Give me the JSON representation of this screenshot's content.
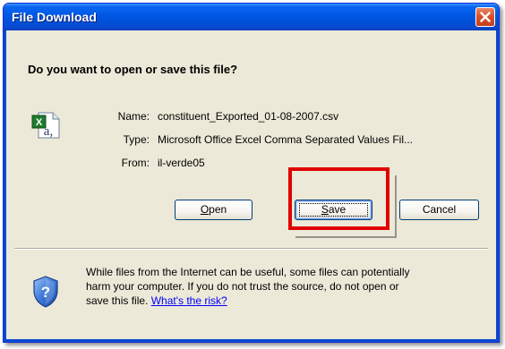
{
  "window": {
    "title": "File Download",
    "close_label": "Close"
  },
  "question": "Do you want to open or save this file?",
  "fields": {
    "name_label": "Name:",
    "name_value": "constituent_Exported_01-08-2007.csv",
    "type_label": "Type:",
    "type_value": "Microsoft Office Excel Comma Separated Values Fil...",
    "from_label": "From:",
    "from_value": "il-verde05"
  },
  "buttons": {
    "open_mnemonic": "O",
    "open_rest": "pen",
    "save_mnemonic": "S",
    "save_rest": "ave",
    "cancel": "Cancel"
  },
  "warning": {
    "line1": "While files from the Internet can be useful, some files can potentially",
    "line2": "harm your computer. If you do not trust the source, do not open or",
    "line3_prefix": "save this file.",
    "link": "What's the risk?"
  },
  "icons": {
    "file": "excel-csv-file-icon",
    "security": "security-shield-icon",
    "close": "close-x-icon"
  },
  "colors": {
    "titlebar": "#0054e3",
    "dialog_bg": "#ece9d8",
    "close_button": "#d9502b",
    "highlight": "#e00000",
    "link": "#0000ff"
  }
}
